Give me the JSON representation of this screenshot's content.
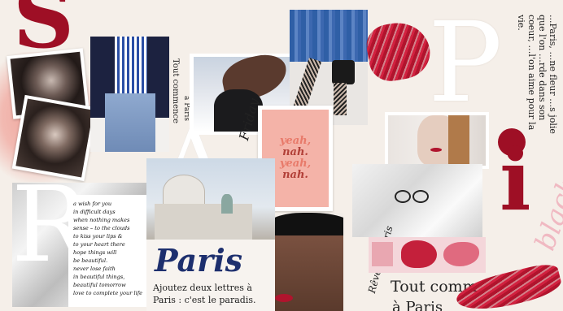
{
  "colors": {
    "background": "#f5efe9",
    "accent_red": "#b0142d",
    "pink": "#f1a9a0",
    "blush": "#e8b3b8",
    "ink": "#222222",
    "navy": "#1d2f6e"
  },
  "letters": {
    "s": "S",
    "a": "A",
    "r": "R",
    "p": "P",
    "i": "i"
  },
  "labels": {
    "tout_commence": "Tout commence",
    "a_paris": "à Paris",
    "friday": "Friday",
    "reveuse_paris": "Rêveuse Paris",
    "black": "black",
    "right_column": "...Paris, …ne fleur …s jolie que l'on …rde dans son coeur, …l'on aime pour la vie.",
    "tout_comm_bottom": "Tout comm",
    "a_paris_bottom": "à Paris"
  },
  "poster": {
    "lines": [
      "yeah,",
      "nah.",
      "yeah,",
      "nah."
    ]
  },
  "paris_card": {
    "title": "Paris",
    "caption": "Ajoutez deux lettres à Paris : c'est le paradis."
  },
  "handwritten_note": {
    "lines": [
      "a wish for you",
      "in difficult days",
      "when nothing makes",
      "sense – to the clouds",
      "to kiss your lips &",
      "to your heart there",
      "hope things will",
      "be beautiful.",
      "never lose faith",
      "in beautiful things,",
      "beautiful tomorrow",
      "love to complete your life"
    ]
  }
}
